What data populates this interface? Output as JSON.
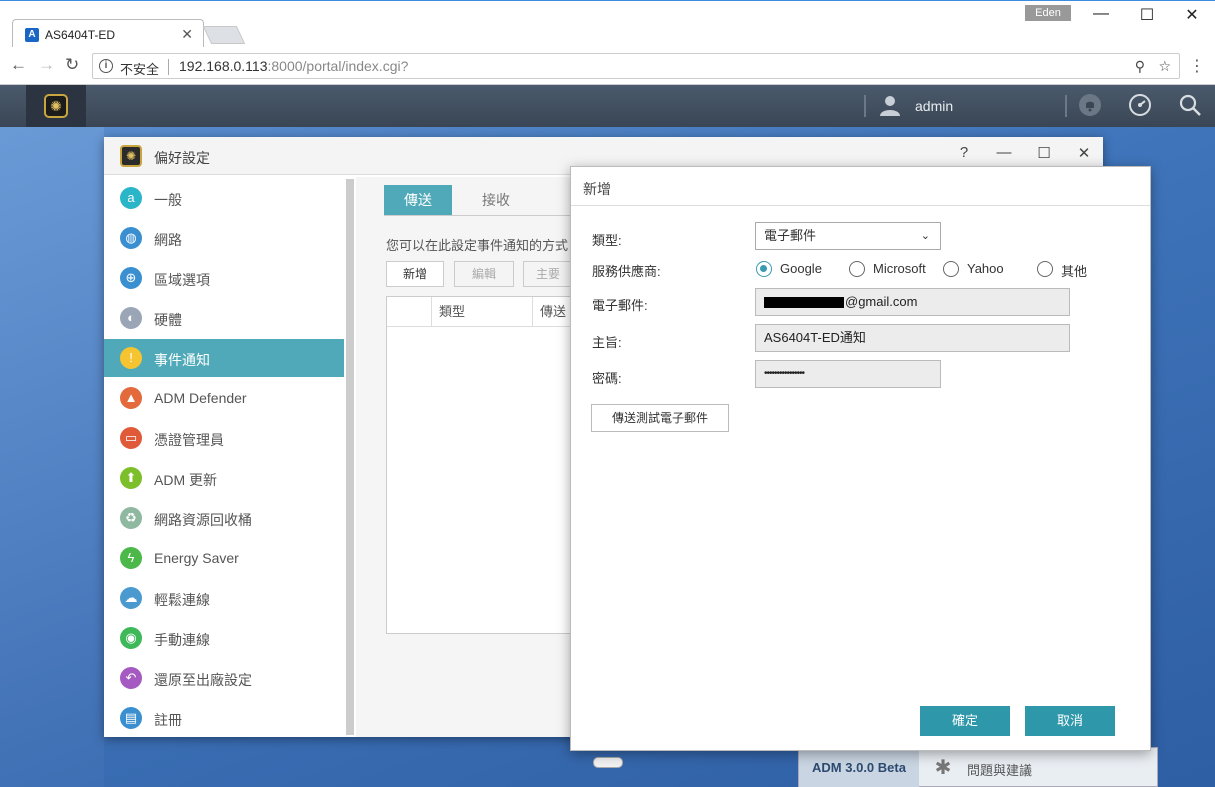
{
  "browser": {
    "tab_title": "AS6404T-ED",
    "tab_favicon": "A",
    "profile_name": "Eden",
    "security_label": "不安全",
    "url_host": "192.168.0.113",
    "url_path": ":8000/portal/index.cgi?",
    "icons": [
      "back-icon",
      "forward-icon",
      "reload-icon",
      "info-icon",
      "key-icon",
      "star-icon",
      "menu-icon"
    ]
  },
  "adm_bar": {
    "username": "admin"
  },
  "taskbar": {
    "version": "ADM 3.0.0 Beta",
    "feedback_label": "問題與建議"
  },
  "prefs": {
    "title": "偏好設定",
    "sidebar": [
      {
        "label": "一般",
        "icon": "general-icon",
        "color": "#2bb5c8"
      },
      {
        "label": "網路",
        "icon": "network-globe-icon",
        "color": "#3a8fd0"
      },
      {
        "label": "區域選項",
        "icon": "region-icon",
        "color": "#3a8fd0"
      },
      {
        "label": "硬體",
        "icon": "hardware-icon",
        "color": "#9aa5b5"
      },
      {
        "label": "事件通知",
        "icon": "alert-icon",
        "color": "#f5c430"
      },
      {
        "label": "ADM Defender",
        "icon": "firewall-icon",
        "color": "#e26a3c"
      },
      {
        "label": "憑證管理員",
        "icon": "certificate-icon",
        "color": "#e05a3a"
      },
      {
        "label": "ADM 更新",
        "icon": "update-arrow-icon",
        "color": "#7cbf2a"
      },
      {
        "label": "網路資源回收桶",
        "icon": "recycle-bin-icon",
        "color": "#8fb8a0"
      },
      {
        "label": "Energy Saver",
        "icon": "energy-icon",
        "color": "#4cb84a"
      },
      {
        "label": "輕鬆連線",
        "icon": "cloud-connect-icon",
        "color": "#4a9ad0"
      },
      {
        "label": "手動連線",
        "icon": "manual-connect-icon",
        "color": "#3fb85a"
      },
      {
        "label": "還原至出廠設定",
        "icon": "restore-icon",
        "color": "#a45ac0"
      },
      {
        "label": "註冊",
        "icon": "register-icon",
        "color": "#3a8fd0"
      }
    ],
    "active_index": 4,
    "tabs": {
      "send": "傳送",
      "receive": "接收"
    },
    "description": "您可以在此設定事件通知的方式",
    "toolbar": {
      "add": "新增",
      "edit": "編輯",
      "primary": "主要"
    },
    "grid_columns": [
      "類型",
      "傳送"
    ]
  },
  "dialog": {
    "title": "新增",
    "type_label": "類型:",
    "type_value": "電子郵件",
    "provider_label": "服務供應商:",
    "providers": [
      "Google",
      "Microsoft",
      "Yahoo",
      "其他"
    ],
    "selected_provider": "Google",
    "email_label": "電子郵件:",
    "email_suffix": "@gmail.com",
    "subject_label": "主旨:",
    "subject_value": "AS6404T-ED通知",
    "password_label": "密碼:",
    "password_value": "••••••••••••••••",
    "test_button": "傳送測試電子郵件",
    "ok_button": "確定",
    "cancel_button": "取消"
  },
  "colors": {
    "accent": "#4fa9b8",
    "button": "#2e98aa",
    "adm_bar": "#3a4655"
  }
}
